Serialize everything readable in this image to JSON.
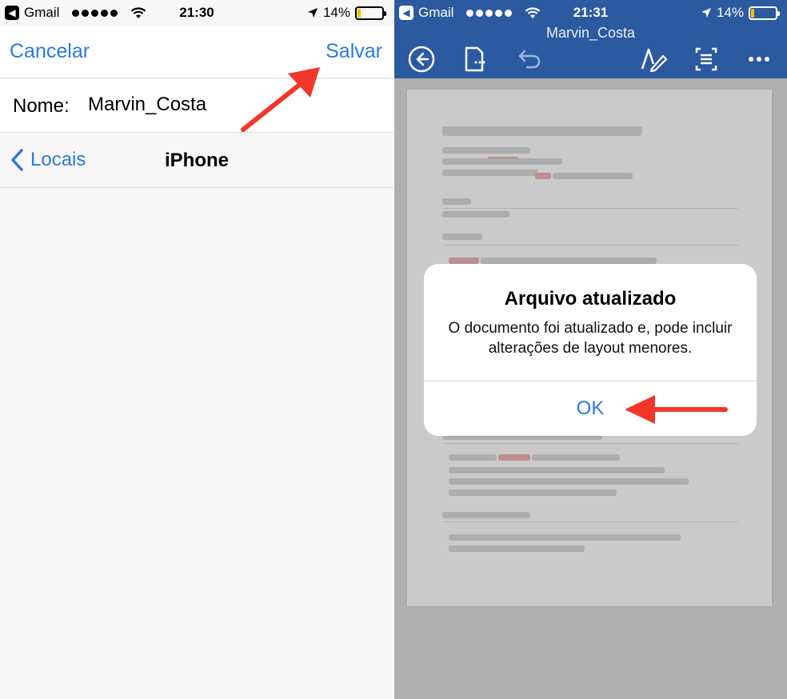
{
  "left": {
    "status": {
      "back_app": "Gmail",
      "time": "21:30",
      "battery": "14%",
      "battery_level": 0.14
    },
    "nav": {
      "cancel": "Cancelar",
      "save": "Salvar"
    },
    "name": {
      "label": "Nome:",
      "value": "Marvin_Costa"
    },
    "location": {
      "back": "Locais",
      "title": "iPhone"
    }
  },
  "right": {
    "status": {
      "back_app": "Gmail",
      "time": "21:31",
      "battery": "14%",
      "battery_level": 0.14
    },
    "doc_title": "Marvin_Costa",
    "toolbar": {
      "icons": [
        "back-circle-icon",
        "document-icon",
        "undo-icon",
        "edit-pen-icon",
        "reading-view-icon",
        "more-icon"
      ]
    },
    "alert": {
      "title": "Arquivo atualizado",
      "message": "O documento foi atualizado e, pode incluir alterações de layout menores.",
      "ok": "OK"
    }
  },
  "colors": {
    "ios_blue": "#2a7adb",
    "word_blue": "#2c5aa0",
    "arrow_red": "#f2362a"
  }
}
